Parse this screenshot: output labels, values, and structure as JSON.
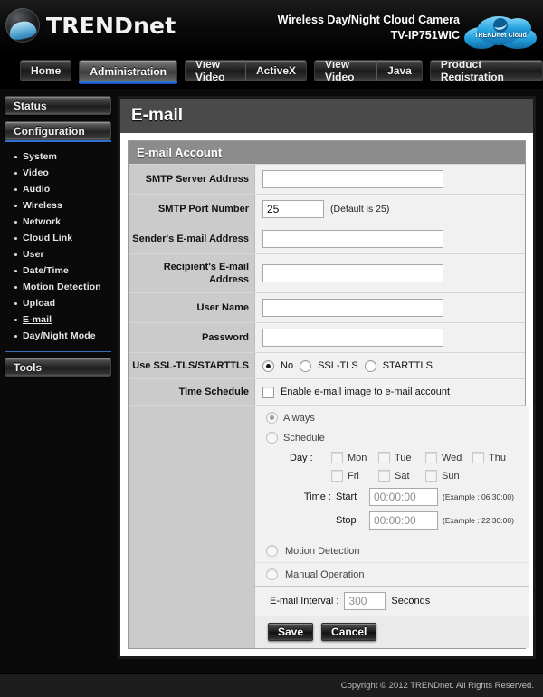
{
  "header": {
    "brand_upper": "TREND",
    "brand_lower": "net",
    "product_line1": "Wireless Day/Night Cloud Camera",
    "product_line2": "TV-IP751WIC",
    "cloud_badge": "TRENDnet Cloud",
    "logo_icon": "trendnet-globe-icon",
    "cloud_icon": "cloud-icon"
  },
  "nav": {
    "tabs": [
      {
        "segments": [
          "Home"
        ],
        "active": false
      },
      {
        "segments": [
          "Administration"
        ],
        "active": true
      },
      {
        "segments": [
          "View Video",
          "ActiveX"
        ],
        "active": false
      },
      {
        "segments": [
          "View Video",
          "Java"
        ],
        "active": false
      },
      {
        "segments": [
          "Product Registration"
        ],
        "active": false
      }
    ]
  },
  "sidebar": {
    "status_label": "Status",
    "configuration_label": "Configuration",
    "tools_label": "Tools",
    "items": [
      {
        "label": "System",
        "active": false
      },
      {
        "label": "Video",
        "active": false
      },
      {
        "label": "Audio",
        "active": false
      },
      {
        "label": "Wireless",
        "active": false
      },
      {
        "label": "Network",
        "active": false
      },
      {
        "label": "Cloud Link",
        "active": false
      },
      {
        "label": "User",
        "active": false
      },
      {
        "label": "Date/Time",
        "active": false
      },
      {
        "label": "Motion Detection",
        "active": false
      },
      {
        "label": "Upload",
        "active": false
      },
      {
        "label": "E-mail",
        "active": true
      },
      {
        "label": "Day/Night Mode",
        "active": false
      }
    ]
  },
  "main": {
    "page_title": "E-mail",
    "panel_title": "E-mail Account",
    "fields": {
      "smtp_server": {
        "label": "SMTP Server Address",
        "value": ""
      },
      "smtp_port": {
        "label": "SMTP Port Number",
        "value": "25",
        "hint": "(Default is 25)"
      },
      "sender": {
        "label": "Sender's E-mail Address",
        "value": ""
      },
      "recipient": {
        "label": "Recipient's E-mail Address",
        "value": ""
      },
      "username": {
        "label": "User Name",
        "value": ""
      },
      "password": {
        "label": "Password",
        "value": ""
      }
    },
    "ssl": {
      "label": "Use SSL-TLS/STARTTLS",
      "options": [
        "No",
        "SSL-TLS",
        "STARTTLS"
      ],
      "selected": "No"
    },
    "time_schedule": {
      "label": "Time Schedule",
      "enable_label": "Enable e-mail image to e-mail account",
      "enabled": false,
      "mode_options": [
        "Always",
        "Schedule",
        "Motion Detection",
        "Manual Operation"
      ],
      "mode_selected": "Always",
      "always_label": "Always",
      "schedule_label": "Schedule",
      "motion_label": "Motion Detection",
      "manual_label": "Manual Operation",
      "day_caption": "Day :",
      "days": [
        {
          "label": "Mon",
          "checked": false
        },
        {
          "label": "Tue",
          "checked": false
        },
        {
          "label": "Wed",
          "checked": false
        },
        {
          "label": "Thu",
          "checked": false
        },
        {
          "label": "Fri",
          "checked": false
        },
        {
          "label": "Sat",
          "checked": false
        },
        {
          "label": "Sun",
          "checked": false
        }
      ],
      "time_caption": "Time :",
      "start_label": "Start",
      "start_value": "00:00:00",
      "start_example": "(Example : 06:30:00)",
      "stop_label": "Stop",
      "stop_value": "00:00:00",
      "stop_example": "(Example : 22:30:00)"
    },
    "interval": {
      "label": "E-mail Interval :",
      "value": "300",
      "unit": "Seconds"
    },
    "buttons": {
      "save": "Save",
      "cancel": "Cancel"
    }
  },
  "footer": {
    "copyright": "Copyright © 2012 TRENDnet.  All Rights Reserved."
  },
  "colors": {
    "accent_blue": "#2f6fd0",
    "panel_header_gray": "#8c8c8c",
    "label_gray": "#cbcbcb",
    "page_bg": "#0a0a0a"
  }
}
